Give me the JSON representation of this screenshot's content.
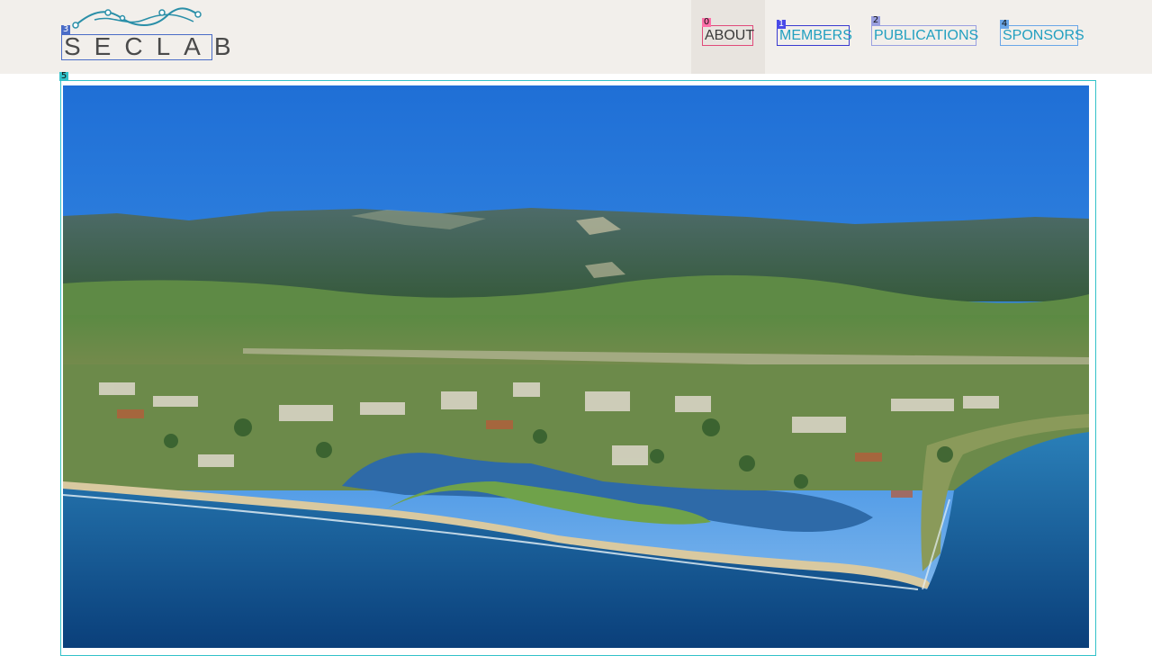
{
  "header": {
    "logo_text": "SECLAB",
    "nav": [
      {
        "label": "ABOUT",
        "active": true
      },
      {
        "label": "MEMBERS"
      },
      {
        "label": "PUBLICATIONS"
      },
      {
        "label": "SPONSORS"
      }
    ]
  },
  "badges": [
    "0",
    "1",
    "2",
    "3",
    "4",
    "5"
  ],
  "colors": {
    "header_bg": "#f2efeb",
    "nav_link": "#22a0c0",
    "nav_active": "#3a3a3a"
  },
  "hero": {
    "icon": "campus-aerial-photo"
  }
}
